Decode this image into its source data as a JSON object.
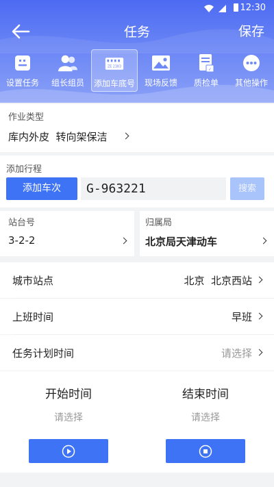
{
  "status_bar": {
    "time": "12:30"
  },
  "header": {
    "title": "任务",
    "save_label": "保存"
  },
  "menu": [
    {
      "label": "设置任务",
      "icon": "task-list-icon"
    },
    {
      "label": "组长组员",
      "icon": "team-icon"
    },
    {
      "label": "添加车底号",
      "icon": "train-number-icon",
      "active": true,
      "badge_text": "ZE 2383"
    },
    {
      "label": "现场反馈",
      "icon": "image-icon"
    },
    {
      "label": "质检单",
      "icon": "inspection-doc-icon"
    },
    {
      "label": "其他操作",
      "icon": "more-icon"
    }
  ],
  "work_type": {
    "label": "作业类型",
    "value": "库内外皮  转向架保洁"
  },
  "trip": {
    "label": "添加行程",
    "add_button": "添加车次",
    "train_value": "G-963221",
    "search_button": "搜索"
  },
  "platform": {
    "label": "站台号",
    "value": "3-2-2"
  },
  "bureau": {
    "label": "归属局",
    "value": "北京局天津动车"
  },
  "rows": [
    {
      "label": "城市站点",
      "value": "北京  北京西站",
      "placeholder": false
    },
    {
      "label": "上班时间",
      "value": "早班",
      "placeholder": false
    },
    {
      "label": "任务计划时间",
      "value": "请选择",
      "placeholder": true
    }
  ],
  "start": {
    "title": "开始时间",
    "value": "请选择"
  },
  "end": {
    "title": "结束时间",
    "value": "请选择"
  },
  "colors": {
    "primary": "#3f73f6",
    "header": "#4d6bf2",
    "disabled": "#a9c3fb"
  }
}
